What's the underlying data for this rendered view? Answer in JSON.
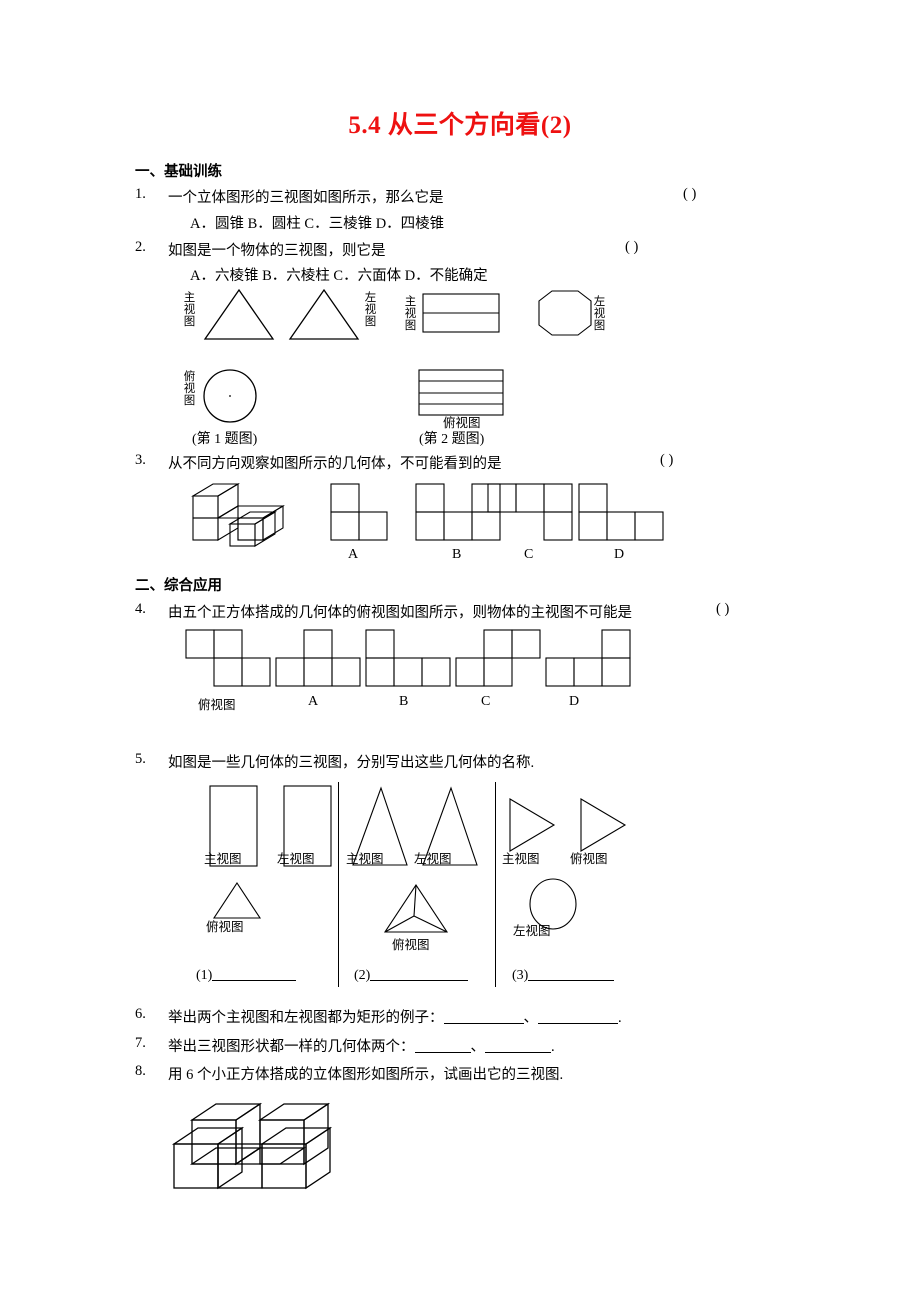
{
  "document": {
    "title": "5.4 从三个方向看(2)",
    "title_color": "#ee1111"
  },
  "sections": [
    {
      "id": "s1",
      "label": "一、基础训练"
    },
    {
      "id": "s2",
      "label": "二、综合应用"
    }
  ],
  "questions": [
    {
      "num": "1.",
      "text": "一个立体图形的三视图如图所示，那么它是",
      "bracket": "(        )",
      "options_line": "A．圆锥      B．圆柱     C．三棱锥       D．四棱锥"
    },
    {
      "num": "2.",
      "text": "如图是一个物体的三视图，则它是",
      "bracket": "(        )",
      "options_line": "A．六棱锥   B．六棱柱   C．六面体     D．不能确定"
    },
    {
      "num": "3.",
      "text": "从不同方向观察如图所示的几何体，不可能看到的是",
      "bracket": "(        )"
    },
    {
      "num": "4.",
      "text": "由五个正方体搭成的几何体的俯视图如图所示，则物体的主视图不可能是",
      "bracket": "(        )"
    },
    {
      "num": "5.",
      "text": "如图是一些几何体的三视图，分别写出这些几何体的名称."
    },
    {
      "num": "6.",
      "text_before": "举出两个主视图和左视图都为矩形的例子：",
      "sep": "、",
      "text_after": "."
    },
    {
      "num": "7.",
      "text_before": "举出三视图形状都一样的几何体两个：",
      "sep": "、",
      "text_after": "."
    },
    {
      "num": "8.",
      "text": "用 6 个小正方体搭成的立体图形如图所示，试画出它的三视图."
    }
  ],
  "figure_q1": {
    "label_front": "主视图",
    "label_side": "左视图",
    "label_top": "俯视图",
    "caption": "(第 1 题图)"
  },
  "figure_q2": {
    "label_front": "主视图",
    "label_side": "左视图",
    "label_top": "俯视图",
    "caption": "(第 2 题图)"
  },
  "figure_q3": {
    "option_labels": [
      "A",
      "B",
      "C",
      "D"
    ],
    "grids": [
      {
        "letter": "A",
        "cols": 2,
        "rows": 2,
        "cells": [
          [
            1,
            0
          ],
          [
            1,
            1
          ]
        ]
      },
      {
        "letter": "B",
        "cols": 3,
        "rows": 2,
        "cells": [
          [
            1,
            0,
            1
          ],
          [
            1,
            1,
            1
          ]
        ]
      },
      {
        "letter": "C",
        "cols": 3,
        "rows": 2,
        "cells": [
          [
            1,
            1,
            1
          ],
          [
            0,
            0,
            1
          ]
        ]
      },
      {
        "letter": "D",
        "cols": 3,
        "rows": 2,
        "cells": [
          [
            1,
            0,
            0
          ],
          [
            1,
            1,
            1
          ]
        ]
      }
    ]
  },
  "figure_q4": {
    "top_view_label": "俯视图",
    "option_labels": [
      "A",
      "B",
      "C",
      "D"
    ],
    "grids": [
      {
        "letter": "俯视图",
        "cols": 3,
        "rows": 2,
        "cells": [
          [
            1,
            1,
            0
          ],
          [
            0,
            1,
            1
          ]
        ]
      },
      {
        "letter": "A",
        "cols": 3,
        "rows": 2,
        "cells": [
          [
            0,
            1,
            0
          ],
          [
            1,
            1,
            1
          ]
        ]
      },
      {
        "letter": "B",
        "cols": 3,
        "rows": 2,
        "cells": [
          [
            1,
            0,
            0
          ],
          [
            1,
            1,
            1
          ]
        ]
      },
      {
        "letter": "C",
        "cols": 3,
        "rows": 2,
        "cells": [
          [
            0,
            1,
            1
          ],
          [
            1,
            1,
            0
          ]
        ]
      },
      {
        "letter": "D",
        "cols": 3,
        "rows": 2,
        "cells": [
          [
            0,
            0,
            1
          ],
          [
            1,
            1,
            1
          ]
        ]
      }
    ]
  },
  "figure_q5": {
    "group1": {
      "front_label": "主视图",
      "side_label": "左视图",
      "top_label": "俯视图",
      "answer_num": "(1)"
    },
    "group2": {
      "front_label": "主视图",
      "side_label": "左视图",
      "top_label": "俯视图",
      "answer_num": "(2)"
    },
    "group3": {
      "front_label": "主视图",
      "top_label": "俯视图",
      "side_label": "左视图",
      "answer_num": "(3)"
    }
  }
}
